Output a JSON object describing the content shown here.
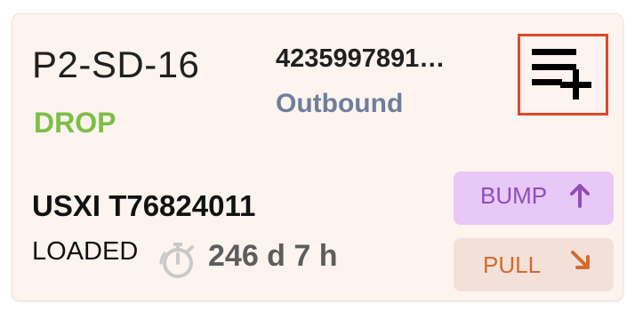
{
  "task": {
    "location": "P2-SD-16",
    "action": "DROP",
    "order_number": "4235997891…",
    "direction": "Outbound",
    "container_id": "USXI T76824011",
    "status": "LOADED",
    "duration": "246 d 7 h"
  },
  "buttons": {
    "bump_label": "BUMP",
    "pull_label": "PULL"
  },
  "icons": {
    "add_list": "playlist-add-icon",
    "timer": "stopwatch-icon",
    "bump": "arrow-up-icon",
    "pull": "arrow-down-right-icon"
  },
  "colors": {
    "card_background": "#fdf3ef",
    "action": "#7cbf45",
    "direction": "#6e7f9c",
    "highlight_border": "#e0472c",
    "bump_background": "#e8c8f6",
    "bump_text": "#8e4fba",
    "pull_background": "#f3e1d9",
    "pull_text": "#d36b2c"
  }
}
